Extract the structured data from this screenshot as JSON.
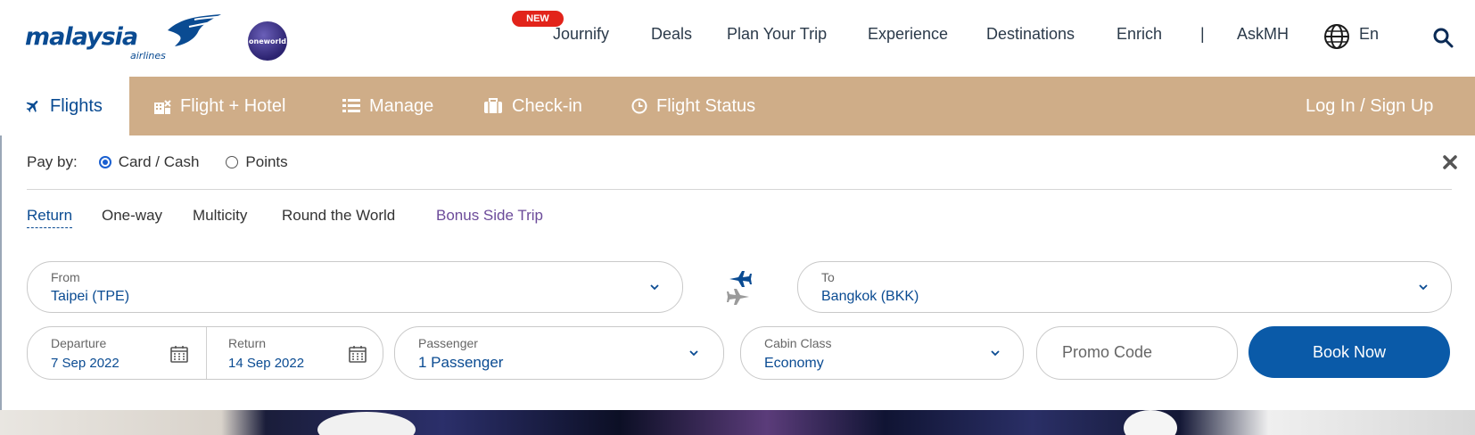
{
  "header": {
    "logo_text": "malaysia",
    "logo_sub": "airlines",
    "oneworld_label": "oneworld",
    "new_badge": "NEW",
    "nav": [
      "Journify",
      "Deals",
      "Plan Your Trip",
      "Experience",
      "Destinations",
      "Enrich",
      "AskMH"
    ],
    "separator": "|",
    "language": "En",
    "icons": [
      "globe-icon",
      "search-icon"
    ]
  },
  "tabs": [
    {
      "label": "Flights",
      "icon": "plane-icon",
      "active": true
    },
    {
      "label": "Flight + Hotel",
      "icon": "hotel-icon",
      "active": false
    },
    {
      "label": "Manage",
      "icon": "list-icon",
      "active": false
    },
    {
      "label": "Check-in",
      "icon": "suitcase-icon",
      "active": false
    },
    {
      "label": "Flight Status",
      "icon": "clock-icon",
      "active": false
    }
  ],
  "login_label": "Log In / Sign Up",
  "booking": {
    "payby_label": "Pay by:",
    "pay_options": [
      {
        "label": "Card / Cash",
        "selected": true
      },
      {
        "label": "Points",
        "selected": false
      }
    ],
    "trip_types": [
      "Return",
      "One-way",
      "Multicity",
      "Round the World",
      "Bonus Side Trip"
    ],
    "active_trip": "Return",
    "from": {
      "label": "From",
      "value": "Taipei (TPE)"
    },
    "to": {
      "label": "To",
      "value": "Bangkok (BKK)"
    },
    "departure": {
      "label": "Departure",
      "value": "7 Sep 2022"
    },
    "return": {
      "label": "Return",
      "value": "14 Sep 2022"
    },
    "passenger": {
      "label": "Passenger",
      "value": "1 Passenger"
    },
    "cabin": {
      "label": "Cabin Class",
      "value": "Economy"
    },
    "promo_placeholder": "Promo Code",
    "book_label": "Book Now"
  },
  "colors": {
    "brand_blue": "#0a4b92",
    "tab_bar": "#cfad88",
    "button_blue": "#0a5aa8",
    "badge_red": "#e2231a",
    "bonus_purple": "#6c4b9a"
  }
}
